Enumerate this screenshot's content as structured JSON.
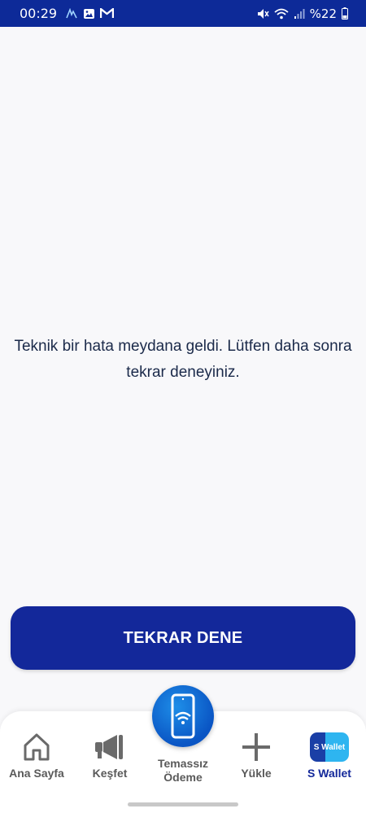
{
  "status_bar": {
    "time": "00:29",
    "battery": "%22"
  },
  "main": {
    "error_message": "Teknik bir hata meydana geldi. Lütfen daha sonra tekrar deneyiniz.",
    "retry_label": "TEKRAR DENE"
  },
  "bottom_nav": {
    "items": [
      {
        "label": "Ana Sayfa",
        "icon": "home-icon",
        "active": false
      },
      {
        "label": "Keşfet",
        "icon": "megaphone-icon",
        "active": false
      },
      {
        "label": "Temassız Ödeme",
        "icon": "contactless-phone-icon",
        "active": false
      },
      {
        "label": "Yükle",
        "icon": "plus-icon",
        "active": false
      },
      {
        "label": "S Wallet",
        "icon": "s-wallet-icon",
        "active": true
      }
    ],
    "wallet_badge_text": "S Wallet"
  },
  "colors": {
    "primary": "#13289a",
    "status_bar": "#0d2a98",
    "background": "#f8f8fa",
    "text": "#1b2a4a",
    "inactive": "#5a5a5a"
  }
}
